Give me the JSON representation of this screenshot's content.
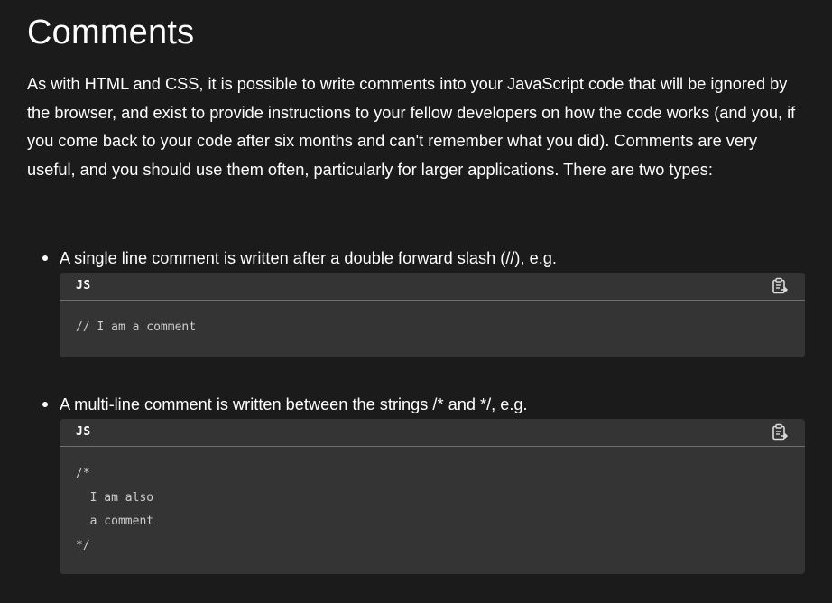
{
  "heading": "Comments",
  "intro": "As with HTML and CSS, it is possible to write comments into your JavaScript code that will be ignored by the browser, and exist to provide instructions to your fellow developers on how the code works (and you, if you come back to your code after six months and can't remember what you did). Comments are very useful, and you should use them often, particularly for larger applications. There are two types:",
  "items": [
    {
      "text": "A single line comment is written after a double forward slash (//), e.g.",
      "code": {
        "lang": "JS",
        "copy_icon": "clipboard-copy-icon",
        "text": "// I am a comment"
      }
    },
    {
      "text": "A multi-line comment is written between the strings /* and */, e.g.",
      "code": {
        "lang": "JS",
        "copy_icon": "clipboard-copy-icon",
        "text": "/*\n  I am also\n  a comment\n*/"
      }
    }
  ]
}
